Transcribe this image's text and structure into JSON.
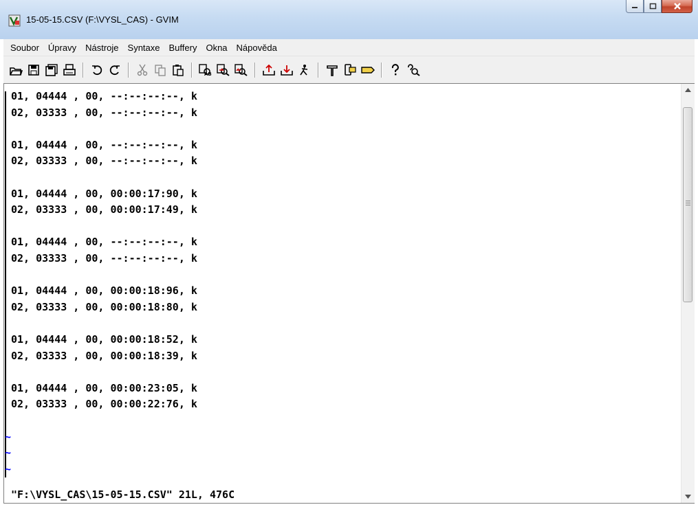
{
  "window": {
    "title": "15-05-15.CSV (F:\\VYSL_CAS) - GVIM",
    "buttons": {
      "minimize": "minimize",
      "maximize": "maximize",
      "close": "close"
    }
  },
  "menu": [
    "Soubor",
    "Úpravy",
    "Nástroje",
    "Syntaxe",
    "Buffery",
    "Okna",
    "Nápověda"
  ],
  "toolbar_icons": [
    [
      "open-icon",
      "save-icon",
      "save-all-icon",
      "print-icon"
    ],
    [
      "undo-icon",
      "redo-icon"
    ],
    [
      "cut-icon",
      "copy-icon",
      "paste-icon"
    ],
    [
      "find-replace-icon",
      "find-next-icon",
      "find-previous-icon"
    ],
    [
      "load-session-icon",
      "save-session-icon",
      "run-script-icon"
    ],
    [
      "make-icon",
      "run-ctags-icon",
      "jump-to-tag-icon"
    ],
    [
      "help-icon",
      "find-help-icon"
    ]
  ],
  "editor": {
    "lines": [
      "01, 04444 , 00, --:--:--:--, k",
      "02, 03333 , 00, --:--:--:--, k",
      "",
      "01, 04444 , 00, --:--:--:--, k",
      "02, 03333 , 00, --:--:--:--, k",
      "",
      "01, 04444 , 00, 00:00:17:90, k",
      "02, 03333 , 00, 00:00:17:49, k",
      "",
      "01, 04444 , 00, --:--:--:--, k",
      "02, 03333 , 00, --:--:--:--, k",
      "",
      "01, 04444 , 00, 00:00:18:96, k",
      "02, 03333 , 00, 00:00:18:80, k",
      "",
      "01, 04444 , 00, 00:00:18:52, k",
      "02, 03333 , 00, 00:00:18:39, k",
      "",
      "01, 04444 , 00, 00:00:23:05, k",
      "02, 03333 , 00, 00:00:22:76, k",
      ""
    ],
    "tilde_lines": [
      "~",
      "~",
      "~"
    ],
    "status": "\"F:\\VYSL_CAS\\15-05-15.CSV\" 21L, 476C"
  },
  "colors": {
    "tilde": "#0000ff",
    "titlebar": "#c6dbf2",
    "close_button": "#c0442b"
  }
}
